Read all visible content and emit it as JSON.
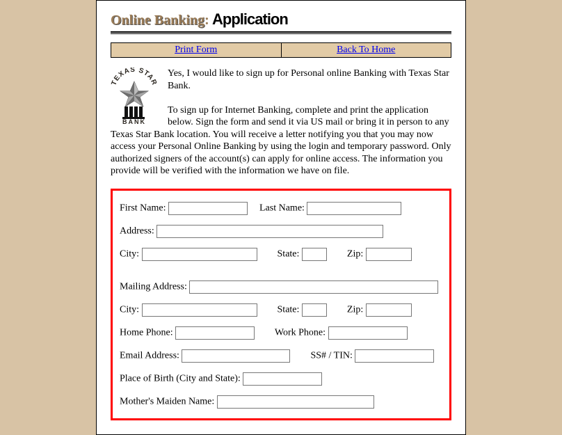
{
  "header": {
    "title_ob": "Online Banking",
    "title_colon": ":",
    "title_app": " Application"
  },
  "nav": {
    "print": "Print Form",
    "home": "Back To Home"
  },
  "logo": {
    "top_text": "TEXAS STAR",
    "bottom_text": "BANK"
  },
  "intro": {
    "line1": "Yes, I would like to sign up for Personal online Banking with Texas Star Bank.",
    "para": "To sign up for Internet Banking, complete and print the application below. Sign the form and send it via US mail or bring it in person to any Texas Star Bank location. You will receive a letter notifying you that you may now access your Personal Online Banking by using the login and temporary password. Only authorized signers of the account(s) can apply for online access. The information you provide will be verified with the information we have on file."
  },
  "form": {
    "first_name_label": "First Name:",
    "last_name_label": "Last Name:",
    "address_label": "Address:",
    "city_label": "City:",
    "state_label": "State:",
    "zip_label": "Zip:",
    "mailing_label": "Mailing Address:",
    "city2_label": "City:",
    "state2_label": "State:",
    "zip2_label": "Zip:",
    "home_phone_label": "Home Phone:",
    "work_phone_label": "Work Phone:",
    "email_label": "Email Address:",
    "ssn_label": "SS# / TIN:",
    "pob_label": "Place of Birth (City and State):",
    "maiden_label": "Mother's Maiden Name:"
  }
}
